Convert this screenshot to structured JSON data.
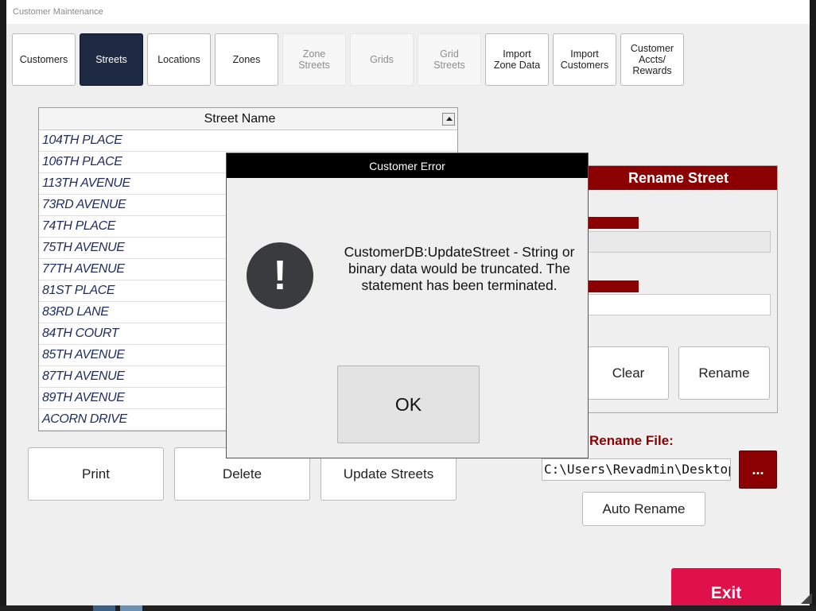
{
  "window": {
    "title": "Customer Maintenance"
  },
  "tabs": [
    {
      "label": "Customers",
      "state": "normal"
    },
    {
      "label": "Streets",
      "state": "active"
    },
    {
      "label": "Locations",
      "state": "normal"
    },
    {
      "label": "Zones",
      "state": "normal"
    },
    {
      "label": "Zone\nStreets",
      "state": "disabled"
    },
    {
      "label": "Grids",
      "state": "disabled"
    },
    {
      "label": "Grid\nStreets",
      "state": "disabled"
    },
    {
      "label": "Import\nZone Data",
      "state": "normal"
    },
    {
      "label": "Import\nCustomers",
      "state": "normal"
    },
    {
      "label": "Customer\nAccts/\nRewards",
      "state": "normal"
    }
  ],
  "street_grid": {
    "header": "Street Name",
    "rows": [
      "104TH PLACE",
      "106TH PLACE",
      "113TH AVENUE",
      "73RD AVENUE",
      "74TH PLACE",
      "75TH AVENUE",
      "77TH AVENUE",
      "81ST PLACE",
      "83RD LANE",
      "84TH COURT",
      "85TH AVENUE",
      "87TH AVENUE",
      "89TH AVENUE",
      "ACORN DRIVE"
    ]
  },
  "actions": {
    "print": "Print",
    "delete": "Delete",
    "update": "Update Streets"
  },
  "rename_panel": {
    "title": "Rename Street",
    "clear": "Clear",
    "rename": "Rename"
  },
  "rename_file": {
    "label": "Rename File:",
    "path": "C:\\Users\\Revadmin\\Desktop",
    "browse": "...",
    "auto_rename": "Auto Rename"
  },
  "exit": "Exit",
  "dialog": {
    "title": "Customer Error",
    "icon": "exclamation-icon",
    "message": "CustomerDB:UpdateStreet - String or binary data would be truncated. The statement has been terminated.",
    "ok": "OK"
  },
  "colors": {
    "accent_red": "#8b0000",
    "active_tab": "#1e2a44",
    "exit_red": "#e0104a",
    "street_text": "#1f2e63"
  }
}
